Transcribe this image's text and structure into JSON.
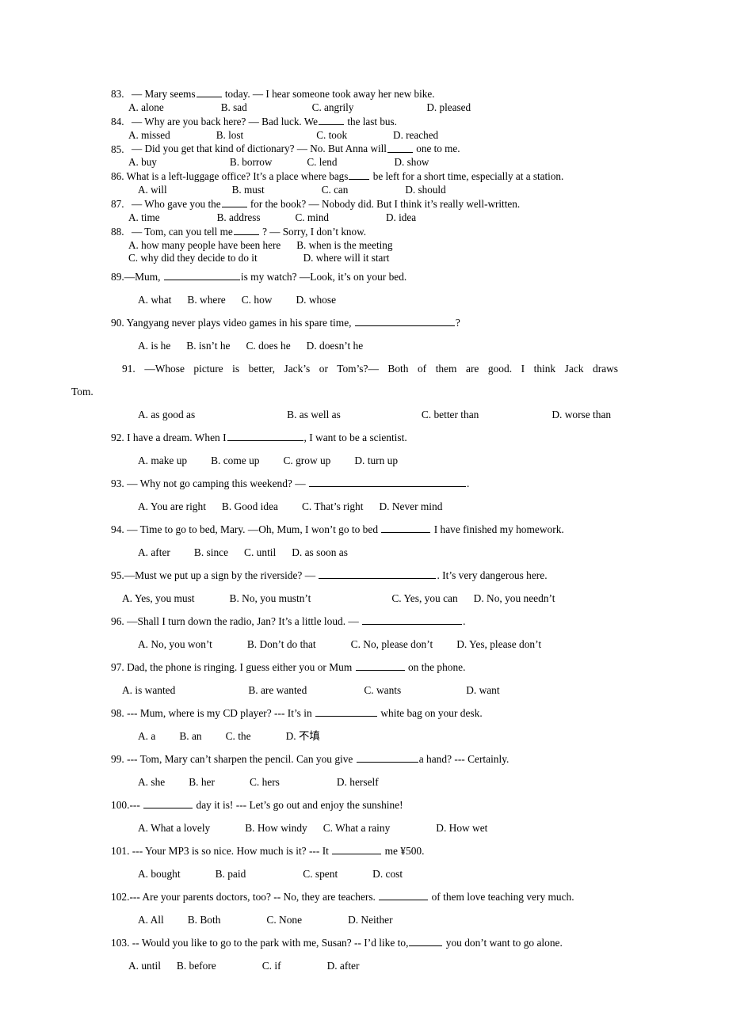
{
  "document": {
    "type": "english-grammar-worksheet",
    "question_range": "83-103"
  },
  "questions": [
    {
      "number": "83.",
      "stem_pre": "—  Mary seems",
      "stem_post": " today.  —  I hear someone took away her new bike.",
      "options": [
        "A. alone",
        "B. sad",
        "C. angrily",
        "D. pleased"
      ]
    },
    {
      "number": "84.",
      "stem_pre": "—  Why are you back here?  —  Bad luck. We",
      "stem_post": " the last bus.",
      "options": [
        "A. missed",
        "B. lost",
        "C. took",
        "D. reached"
      ]
    },
    {
      "number": "85.",
      "stem_pre": "—  Did you get that kind of dictionary? — No. But Anna will",
      "stem_post": " one to me.",
      "options": [
        "A. buy",
        "B. borrow",
        "C. lend",
        "D. show"
      ]
    },
    {
      "number": "86.",
      "stem_pre": "What is a left-luggage office? It’s a place where bags",
      "stem_post": " be left for a short time, especially at a station.",
      "options": [
        "A. will",
        "B. must",
        "C. can",
        "D. should"
      ]
    },
    {
      "number": "87.",
      "stem_pre": "—  Who gave you the",
      "stem_post": " for the book?  —  Nobody did. But I think it’s really well-written.",
      "options": [
        "A. time",
        "B. address",
        "C. mind",
        "D. idea"
      ]
    },
    {
      "number": "88.",
      "stem_pre": "—  Tom, can you tell me",
      "stem_post": " ?  —  Sorry, I don’t know.",
      "options": [
        "A. how many people have been here",
        "B. when is the meeting",
        "C. why did they decide to do it",
        "D. where will it start"
      ]
    },
    {
      "number": "89.",
      "stem_pre": "—Mum,",
      "stem_post": "is my watch?  —Look, it’s on your bed.",
      "options": [
        "A. what",
        "B. where",
        "C. how",
        "D. whose"
      ]
    },
    {
      "number": "90.",
      "stem_pre": "Yangyang never plays video games in his spare time,",
      "stem_post": "?",
      "options": [
        "A. is he",
        "B. isn’t he",
        "C. does he",
        "D. doesn’t he"
      ]
    },
    {
      "number": "91.",
      "stem_pre": "—Whose picture is better, Jack’s or Tom’s?— Both of them are good. I think Jack draws",
      "stem_post": "Tom.",
      "options": [
        "A. as good as",
        "B. as well as",
        "C. better than",
        "D. worse than"
      ]
    },
    {
      "number": "92.",
      "stem_pre": "I have a dream. When I",
      "stem_post": ", I want to be a scientist.",
      "options": [
        "A. make up",
        "B. come up",
        "C. grow up",
        "D. turn up"
      ]
    },
    {
      "number": "93.",
      "stem_pre": "— Why not go camping this weekend? —",
      "stem_post": ".",
      "options": [
        "A. You are right",
        "B. Good idea",
        "C. That’s right",
        "D. Never mind"
      ]
    },
    {
      "number": "94.",
      "stem_pre": "— Time to go to bed, Mary. —Oh, Mum, I won’t go to bed",
      "stem_post": " I have finished my homework.",
      "options": [
        "A. after",
        "B. since",
        "C. until",
        "D. as soon as"
      ]
    },
    {
      "number": "95.",
      "stem_pre": "—Must we put up a sign by the riverside? —",
      "stem_post": ". It’s very dangerous here.",
      "options": [
        "A. Yes, you must",
        "B. No, you mustn’t",
        "C. Yes, you can",
        "D. No, you needn’t"
      ]
    },
    {
      "number": "96.",
      "stem_pre": "—Shall I turn down the radio, Jan? It’s a little loud.   —",
      "stem_post": ".",
      "options": [
        "A. No, you won’t",
        "B. Don’t do that",
        "C. No, please don’t",
        "D. Yes, please don’t"
      ]
    },
    {
      "number": "97.",
      "stem_pre": "Dad, the phone is ringing. I guess either you or Mum",
      "stem_post": " on the phone.",
      "options": [
        "A. is wanted",
        "B. are wanted",
        "C. wants",
        "D. want"
      ]
    },
    {
      "number": "98.",
      "stem_pre": "--- Mum, where is my CD player?   --- It’s in",
      "stem_post": " white bag on your desk.",
      "options": [
        "A. a",
        "B. an",
        "C. the",
        "D. 不填"
      ]
    },
    {
      "number": "99.",
      "stem_pre": "--- Tom, Mary can’t sharpen the pencil. Can you give",
      "stem_post": "a hand?    --- Certainly.",
      "options": [
        "A. she",
        "B. her",
        "C. hers",
        "D. herself"
      ]
    },
    {
      "number": "100.",
      "stem_pre": "---",
      "stem_post": " day it is!   --- Let’s go out and enjoy the sunshine!",
      "options": [
        "A. What a lovely",
        "B. How windy",
        "C. What a rainy",
        "D. How wet"
      ]
    },
    {
      "number": "101.",
      "stem_pre": "--- Your MP3 is so nice. How much is it? --- It",
      "stem_post": " me ¥500.",
      "options": [
        "A. bought",
        "B. paid",
        "C. spent",
        "D. cost"
      ]
    },
    {
      "number": "102.",
      "stem_pre": "--- Are your parents doctors, too?   -- No, they are teachers.",
      "stem_post": " of them love teaching very much.",
      "options": [
        "A. All",
        "B. Both",
        "C. None",
        "D. Neither"
      ]
    },
    {
      "number": "103.",
      "stem_pre": "-- Would you like to go to the park with me, Susan? -- I’d like to,",
      "stem_post": " you don’t want to go alone.",
      "options": [
        "A. until",
        "B. before",
        "C. if",
        "D. after"
      ]
    }
  ]
}
